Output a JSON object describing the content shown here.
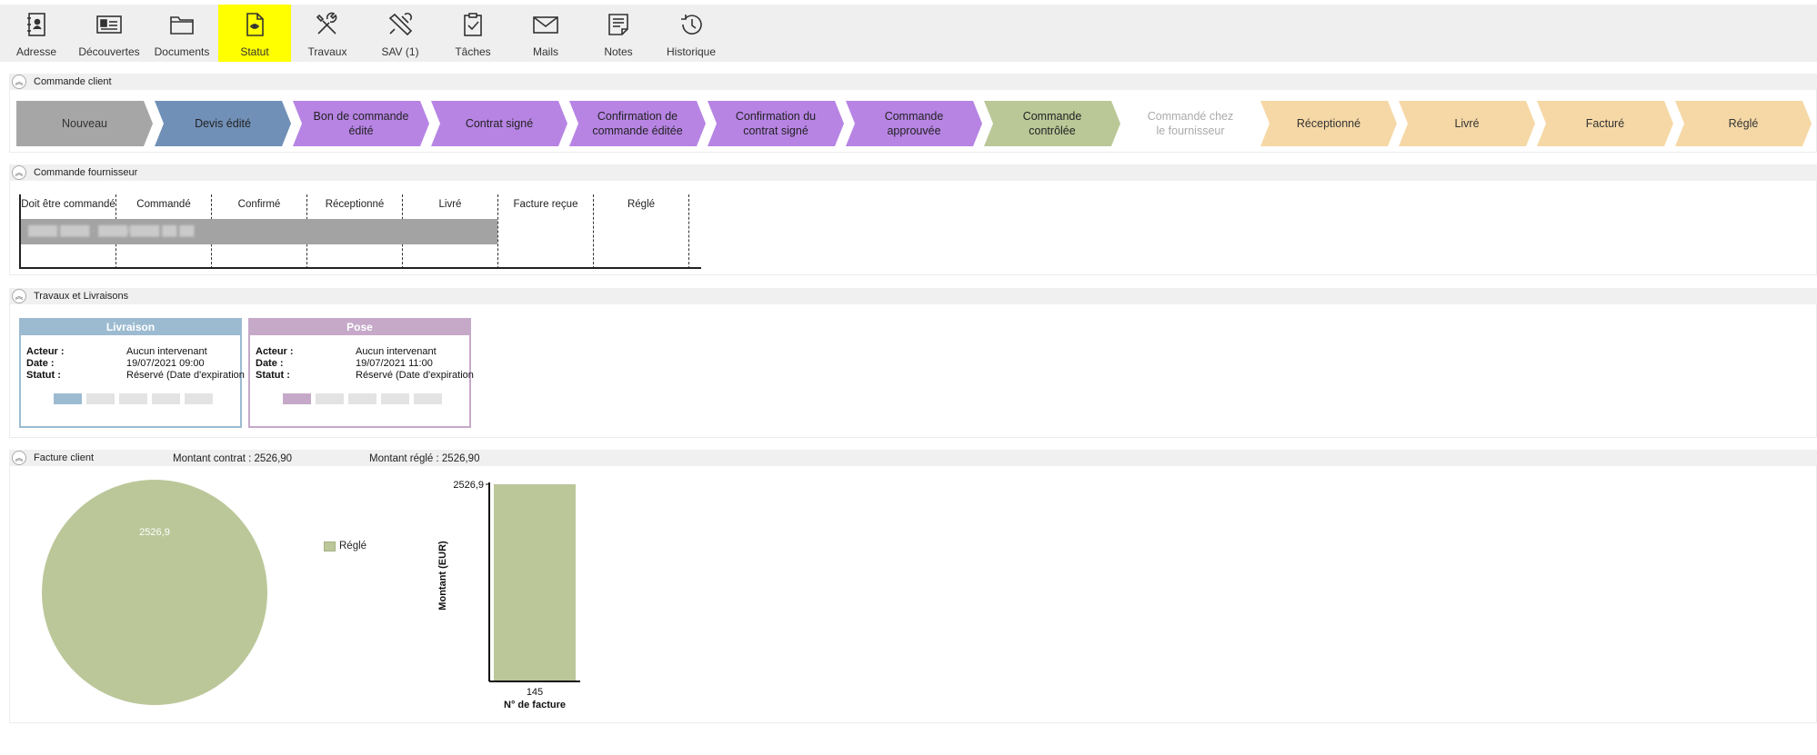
{
  "toolbar": {
    "items": [
      {
        "label": "Adresse",
        "icon": "address-book-icon"
      },
      {
        "label": "Découvertes",
        "icon": "id-card-icon"
      },
      {
        "label": "Documents",
        "icon": "folder-icon"
      },
      {
        "label": "Statut",
        "icon": "status-document-icon",
        "active": true
      },
      {
        "label": "Travaux",
        "icon": "tools-icon"
      },
      {
        "label": "SAV (1)",
        "icon": "wrench-support-icon"
      },
      {
        "label": "Tâches",
        "icon": "clipboard-check-icon"
      },
      {
        "label": "Mails",
        "icon": "envelope-icon"
      },
      {
        "label": "Notes",
        "icon": "notepad-icon"
      },
      {
        "label": "Historique",
        "icon": "history-icon"
      }
    ],
    "active_color": "#ffff00"
  },
  "commande_client": {
    "title": "Commande client",
    "steps": [
      {
        "label": "Nouveau",
        "color": "#a6a6a6",
        "text_color": "#333333"
      },
      {
        "label": "Devis édité",
        "color": "#7090b7",
        "text_color": "#222222"
      },
      {
        "label": "Bon de commande édité",
        "color": "#b784e4",
        "text_color": "#222222"
      },
      {
        "label": "Contrat signé",
        "color": "#b784e4",
        "text_color": "#222222"
      },
      {
        "label": "Confirmation de commande éditée",
        "color": "#b784e4",
        "text_color": "#222222"
      },
      {
        "label": "Confirmation du contrat signé",
        "color": "#b784e4",
        "text_color": "#222222"
      },
      {
        "label": "Commande approuvée",
        "color": "#b784e4",
        "text_color": "#222222"
      },
      {
        "label": "Commande contrôlée",
        "color": "#bac897",
        "text_color": "#222222"
      },
      {
        "label": "Commandé chez le fournisseur",
        "color": "#ffffff",
        "text_color": "#aaaaaa"
      },
      {
        "label": "Réceptionné",
        "color": "#f6d8a6",
        "text_color": "#333333"
      },
      {
        "label": "Livré",
        "color": "#f6d8a6",
        "text_color": "#333333"
      },
      {
        "label": "Facturé",
        "color": "#f6d8a6",
        "text_color": "#333333"
      },
      {
        "label": "Réglé",
        "color": "#f6d8a6",
        "text_color": "#333333"
      }
    ]
  },
  "commande_fournisseur": {
    "title": "Commande fournisseur",
    "columns": [
      "Doit être commandé",
      "Commandé",
      "Confirmé",
      "Réceptionné",
      "Livré",
      "Facture reçue",
      "Réglé"
    ],
    "bar_color": "#a3a3a3"
  },
  "travaux": {
    "title": "Travaux et Livraisons",
    "cards": [
      {
        "title": "Livraison",
        "color": "#9cbbd1",
        "rows": [
          {
            "key": "Acteur :",
            "value": "Aucun intervenant"
          },
          {
            "key": "Date :",
            "value": "19/07/2021 09:00"
          },
          {
            "key": "Statut :",
            "value": "Réservé (Date d'expiration"
          }
        ]
      },
      {
        "title": "Pose",
        "color": "#c6a9c9",
        "rows": [
          {
            "key": "Acteur :",
            "value": "Aucun intervenant"
          },
          {
            "key": "Date :",
            "value": "19/07/2021 11:00"
          },
          {
            "key": "Statut :",
            "value": "Réservé (Date d'expiration"
          }
        ]
      }
    ]
  },
  "facture_client": {
    "title": "Facture client",
    "montant_contrat": "Montant contrat : 2526,90",
    "montant_regle": "Montant réglé : 2526,90",
    "legend_label": "Réglé"
  },
  "chart_data": [
    {
      "type": "pie",
      "labels": [
        "Réglé"
      ],
      "values": [
        2526.9
      ],
      "value_label": "2526,9",
      "colors": [
        "#bbc799"
      ],
      "legend": "right"
    },
    {
      "type": "bar",
      "categories": [
        "145"
      ],
      "values": [
        2526.9
      ],
      "value_label": "2526,9",
      "xlabel": "N° de facture",
      "ylabel": "Montant (EUR)",
      "ylim": [
        0,
        2526.9
      ],
      "colors": [
        "#bbc799"
      ],
      "grid": false
    }
  ]
}
